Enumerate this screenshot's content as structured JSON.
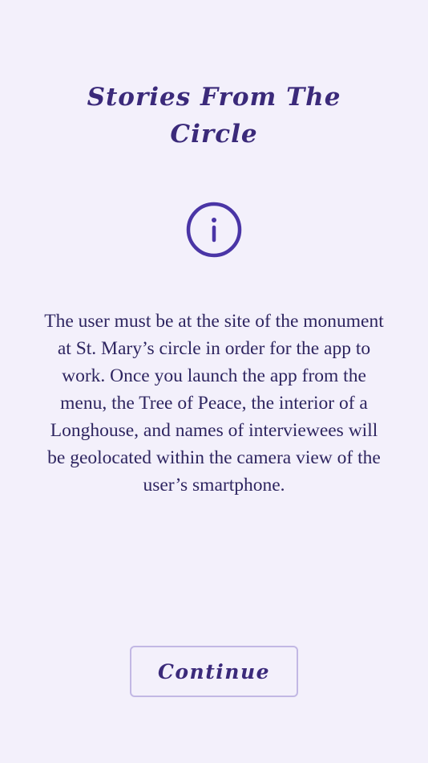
{
  "screen": {
    "title": "Stories From The Circle",
    "icon": "info-icon",
    "message": "The user must be at the site of the monument at St. Mary’s circle in order for the app to work. Once you launch the app from the menu, the Tree of Peace, the interior of a Longhouse, and names of interviewees will be geolocated within the camera view of the user’s smartphone.",
    "continue_label": "Continue"
  },
  "colors": {
    "background": "#f3f0fb",
    "accent": "#4a35a6",
    "text": "#2e2560",
    "button_border": "#c2b8e4"
  }
}
